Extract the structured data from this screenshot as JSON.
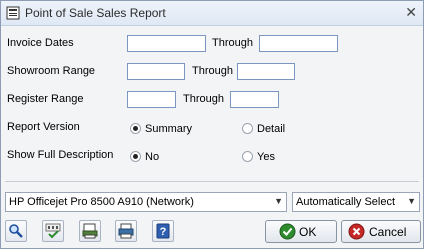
{
  "window": {
    "title": "Point of Sale Sales Report",
    "close_glyph": "✕"
  },
  "form": {
    "invoice_dates": {
      "label": "Invoice Dates",
      "through_label": "Through",
      "from": "",
      "to": ""
    },
    "showroom_range": {
      "label": "Showroom Range",
      "through_label": "Through",
      "from": "",
      "to": ""
    },
    "register_range": {
      "label": "Register Range",
      "through_label": "Through",
      "from": "",
      "to": ""
    },
    "report_version": {
      "label": "Report Version",
      "options": [
        "Summary",
        "Detail"
      ],
      "selected": "Summary"
    },
    "show_full_description": {
      "label": "Show Full Description",
      "options": [
        "No",
        "Yes"
      ],
      "selected": "No"
    }
  },
  "printer": {
    "selected": "HP Officejet Pro 8500 A910 (Network)"
  },
  "tray": {
    "selected": "Automatically Select"
  },
  "toolbar": {
    "icons": [
      "search-icon",
      "spellcheck-icon",
      "print-preview-icon",
      "print-icon",
      "help-icon"
    ]
  },
  "buttons": {
    "ok_label": "OK",
    "cancel_label": "Cancel"
  },
  "colors": {
    "accent": "#7a96c1",
    "ok_green": "#2e8b2e",
    "cancel_red": "#c62828"
  }
}
